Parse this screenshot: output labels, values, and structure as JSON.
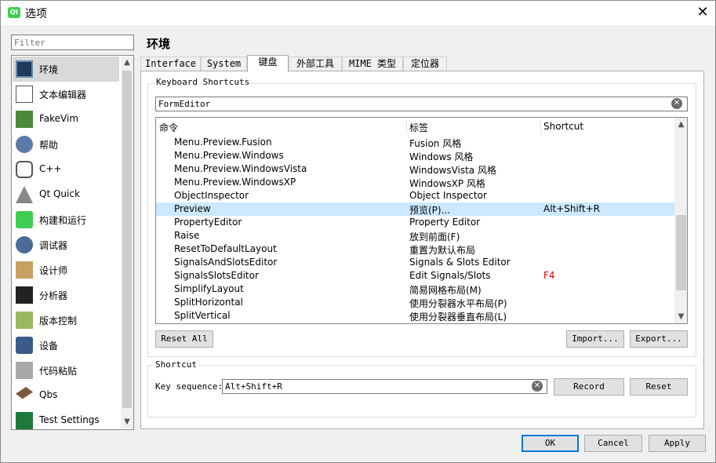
{
  "window": {
    "title": "选项",
    "app_icon": "Qt",
    "close_glyph": "✕"
  },
  "filter": {
    "placeholder": "Filter"
  },
  "categories": [
    {
      "label": "环境",
      "icon": "environment-icon",
      "selected": true
    },
    {
      "label": "文本编辑器",
      "icon": "text-editor-icon"
    },
    {
      "label": "FakeVim",
      "icon": "fakevim-icon"
    },
    {
      "label": "帮助",
      "icon": "help-icon"
    },
    {
      "label": "C++",
      "icon": "cpp-icon"
    },
    {
      "label": "Qt Quick",
      "icon": "qt-quick-icon"
    },
    {
      "label": "构建和运行",
      "icon": "build-run-icon"
    },
    {
      "label": "调试器",
      "icon": "debugger-icon"
    },
    {
      "label": "设计师",
      "icon": "designer-icon"
    },
    {
      "label": "分析器",
      "icon": "analyzer-icon"
    },
    {
      "label": "版本控制",
      "icon": "version-control-icon"
    },
    {
      "label": "设备",
      "icon": "devices-icon"
    },
    {
      "label": "代码粘贴",
      "icon": "code-pasting-icon"
    },
    {
      "label": "Qbs",
      "icon": "qbs-icon"
    },
    {
      "label": "Test Settings",
      "icon": "test-settings-icon"
    }
  ],
  "page": {
    "title": "环境"
  },
  "tabs": [
    {
      "label": "Interface"
    },
    {
      "label": "System"
    },
    {
      "label": "键盘",
      "active": true
    },
    {
      "label": "外部工具"
    },
    {
      "label": "MIME 类型"
    },
    {
      "label": "定位器"
    }
  ],
  "keyboard_shortcuts": {
    "group_title": "Keyboard Shortcuts",
    "search_value": "FormEditor",
    "columns": [
      "命令",
      "标签",
      "Shortcut"
    ],
    "rows": [
      {
        "command": "Menu.Preview.Fusion",
        "label": "Fusion 风格",
        "shortcut": ""
      },
      {
        "command": "Menu.Preview.Windows",
        "label": "Windows 风格",
        "shortcut": ""
      },
      {
        "command": "Menu.Preview.WindowsVista",
        "label": "WindowsVista 风格",
        "shortcut": ""
      },
      {
        "command": "Menu.Preview.WindowsXP",
        "label": "WindowsXP 风格",
        "shortcut": ""
      },
      {
        "command": "ObjectInspector",
        "label": "Object Inspector",
        "shortcut": ""
      },
      {
        "command": "Preview",
        "label": "预览(P)...",
        "shortcut": "Alt+Shift+R",
        "selected": true
      },
      {
        "command": "PropertyEditor",
        "label": "Property Editor",
        "shortcut": ""
      },
      {
        "command": "Raise",
        "label": "放到前面(F)",
        "shortcut": ""
      },
      {
        "command": "ResetToDefaultLayout",
        "label": "重置为默认布局",
        "shortcut": ""
      },
      {
        "command": "SignalsAndSlotsEditor",
        "label": "Signals & Slots Editor",
        "shortcut": ""
      },
      {
        "command": "SignalsSlotsEditor",
        "label": "Edit Signals/Slots",
        "shortcut": "F4",
        "conflict": true
      },
      {
        "command": "SimplifyLayout",
        "label": "简易网格布局(M)",
        "shortcut": ""
      },
      {
        "command": "SplitHorizontal",
        "label": "使用分裂器水平布局(P)",
        "shortcut": ""
      },
      {
        "command": "SplitVertical",
        "label": "使用分裂器垂直布局(L)",
        "shortcut": ""
      }
    ],
    "reset_all": "Reset All",
    "import": "Import...",
    "export": "Export..."
  },
  "shortcut": {
    "group_title": "Shortcut",
    "key_sequence_label": "Key sequence:",
    "key_sequence_value": "Alt+Shift+R",
    "record": "Record",
    "reset": "Reset"
  },
  "footer": {
    "ok": "OK",
    "cancel": "Cancel",
    "apply": "Apply"
  },
  "colors": {
    "selection": "#cce8ff",
    "conflict": "#e00000",
    "default_button_border": "#0078d7"
  }
}
